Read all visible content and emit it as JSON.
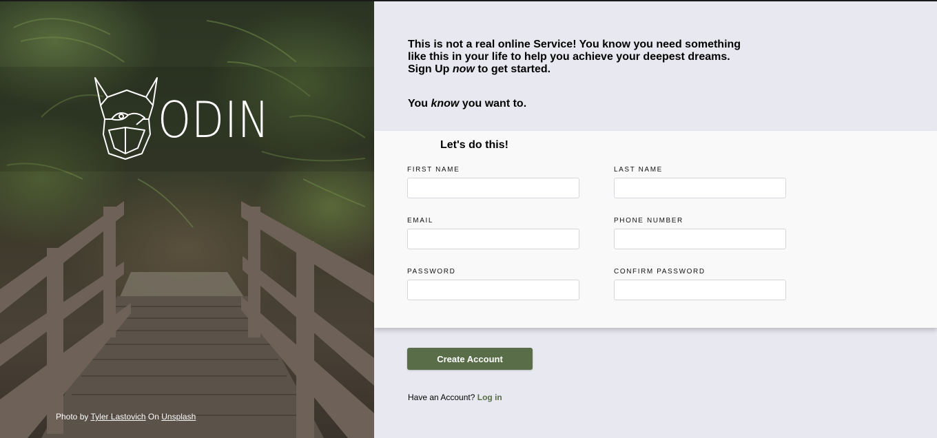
{
  "hero": {
    "brand_name": "ODIN",
    "credit": {
      "prefix": "Photo by",
      "photographer": "Tyler Lastovich",
      "middle": "On",
      "source": "Unsplash"
    }
  },
  "intro": {
    "line1_a": "This is not a real online Service! You know you need something like this in your life to help you achieve your deepest dreams. Sign Up ",
    "line1_em": "now",
    "line1_b": " to get started.",
    "line2_a": "You ",
    "line2_em": "know",
    "line2_b": " you want to."
  },
  "form": {
    "heading": "Let's do this!",
    "fields": {
      "first_name": {
        "label": "FIRST NAME",
        "value": ""
      },
      "last_name": {
        "label": "LAST NAME",
        "value": ""
      },
      "email": {
        "label": "EMAIL",
        "value": ""
      },
      "phone": {
        "label": "PHONE NUMBER",
        "value": ""
      },
      "password": {
        "label": "PASSWORD",
        "value": ""
      },
      "confirm_password": {
        "label": "CONFIRM PASSWORD",
        "value": ""
      }
    }
  },
  "actions": {
    "create_label": "Create Account",
    "have_account": "Have an Account?",
    "login_label": "Log in"
  },
  "colors": {
    "accent": "#596d48",
    "page_bg": "#e8e8f0",
    "card_bg": "#f9f9f9"
  }
}
